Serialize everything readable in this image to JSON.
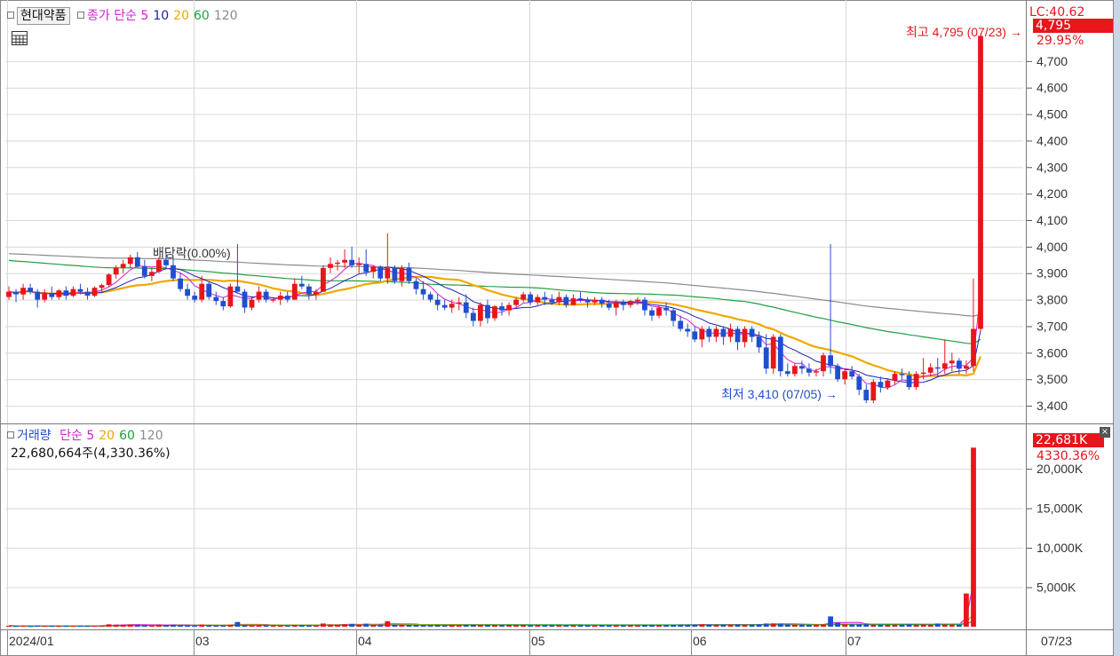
{
  "colors": {
    "up": "#e8151b",
    "down": "#1f4fd0",
    "ma5": "#d020d0",
    "ma10": "#2020b0",
    "ma20": "#f0a800",
    "ma60": "#20a040",
    "ma120": "#8a8a8a",
    "grid": "#d8d8d8",
    "panel_bg": "#c9d6e6"
  },
  "header": {
    "stock_name": "현대약품",
    "price_label": "종가 단순",
    "ma5": "5",
    "ma10": "10",
    "ma20": "20",
    "ma60": "60",
    "ma120": "120",
    "table_icon": "table-icon"
  },
  "price_panel": {
    "dividend_label": "배당락(0.00%)",
    "high_marker": "최고 4,795 (07/23) →",
    "low_marker": "최저 3,410 (07/05) →",
    "badge_top": "LC:40.62",
    "badge_price": "4,795",
    "badge_change": "29.95%",
    "axis_labels": [
      "4,700",
      "4,600",
      "4,500",
      "4,400",
      "4,300",
      "4,200",
      "4,100",
      "4,000",
      "3,900",
      "3,800",
      "3,700",
      "3,600",
      "3,500",
      "3,400"
    ]
  },
  "volume_panel": {
    "title": "거래량",
    "ma_label": "단순",
    "ma5": "5",
    "ma20": "20",
    "ma60": "60",
    "ma120": "120",
    "value_text": "22,680,664주(4,330.36%)",
    "badge_value": "22,681K",
    "badge_pct": "4330.36%",
    "axis_labels": [
      "20,000K",
      "15,000K",
      "10,000K",
      "5,000K"
    ]
  },
  "x_axis": {
    "labels": [
      "2024/01",
      "03",
      "04",
      "05",
      "06",
      "07"
    ],
    "right_label": "07/23"
  },
  "chart_data": {
    "type": "candlestick",
    "price_ylim": [
      3350,
      4830
    ],
    "volume_ylim": [
      0,
      23500
    ],
    "volume_unit": "K",
    "ohlc": [
      [
        3810,
        3850,
        3800,
        3830
      ],
      [
        3830,
        3840,
        3790,
        3820
      ],
      [
        3820,
        3860,
        3800,
        3845
      ],
      [
        3845,
        3860,
        3820,
        3830
      ],
      [
        3830,
        3840,
        3770,
        3800
      ],
      [
        3800,
        3840,
        3790,
        3825
      ],
      [
        3825,
        3850,
        3800,
        3810
      ],
      [
        3810,
        3840,
        3800,
        3835
      ],
      [
        3835,
        3850,
        3800,
        3815
      ],
      [
        3815,
        3850,
        3810,
        3840
      ],
      [
        3840,
        3860,
        3820,
        3830
      ],
      [
        3830,
        3845,
        3800,
        3815
      ],
      [
        3815,
        3850,
        3810,
        3845
      ],
      [
        3845,
        3860,
        3830,
        3855
      ],
      [
        3855,
        3900,
        3850,
        3895
      ],
      [
        3895,
        3930,
        3880,
        3920
      ],
      [
        3920,
        3950,
        3900,
        3935
      ],
      [
        3935,
        3970,
        3920,
        3960
      ],
      [
        3960,
        3980,
        3920,
        3925
      ],
      [
        3925,
        3950,
        3880,
        3890
      ],
      [
        3890,
        3920,
        3870,
        3905
      ],
      [
        3905,
        3960,
        3900,
        3950
      ],
      [
        3950,
        3980,
        3920,
        3930
      ],
      [
        3930,
        3960,
        3870,
        3880
      ],
      [
        3880,
        3900,
        3830,
        3840
      ],
      [
        3840,
        3860,
        3800,
        3815
      ],
      [
        3815,
        3830,
        3790,
        3800
      ],
      [
        3800,
        3890,
        3790,
        3860
      ],
      [
        3860,
        3870,
        3800,
        3810
      ],
      [
        3810,
        3830,
        3780,
        3795
      ],
      [
        3795,
        3810,
        3760,
        3775
      ],
      [
        3775,
        3860,
        3770,
        3850
      ],
      [
        3850,
        4010,
        3830,
        3830
      ],
      [
        3830,
        3840,
        3750,
        3770
      ],
      [
        3770,
        3810,
        3760,
        3800
      ],
      [
        3800,
        3850,
        3790,
        3830
      ],
      [
        3830,
        3840,
        3790,
        3800
      ],
      [
        3800,
        3810,
        3790,
        3800
      ],
      [
        3800,
        3830,
        3780,
        3815
      ],
      [
        3815,
        3830,
        3790,
        3800
      ],
      [
        3800,
        3880,
        3800,
        3860
      ],
      [
        3860,
        3890,
        3840,
        3850
      ],
      [
        3850,
        3860,
        3800,
        3820
      ],
      [
        3820,
        3840,
        3800,
        3830
      ],
      [
        3830,
        3930,
        3830,
        3920
      ],
      [
        3920,
        3960,
        3900,
        3935
      ],
      [
        3935,
        3950,
        3910,
        3940
      ],
      [
        3940,
        3990,
        3920,
        3950
      ],
      [
        3950,
        4000,
        3920,
        3930
      ],
      [
        3930,
        3960,
        3900,
        3935
      ],
      [
        3935,
        3990,
        3890,
        3905
      ],
      [
        3905,
        3930,
        3880,
        3925
      ],
      [
        3925,
        3930,
        3870,
        3880
      ],
      [
        3880,
        4050,
        3860,
        3920
      ],
      [
        3920,
        3930,
        3860,
        3870
      ],
      [
        3870,
        3930,
        3850,
        3920
      ],
      [
        3920,
        3940,
        3860,
        3870
      ],
      [
        3870,
        3880,
        3820,
        3840
      ],
      [
        3840,
        3870,
        3800,
        3820
      ],
      [
        3820,
        3830,
        3790,
        3800
      ],
      [
        3800,
        3820,
        3760,
        3780
      ],
      [
        3780,
        3800,
        3760,
        3770
      ],
      [
        3770,
        3800,
        3750,
        3785
      ],
      [
        3785,
        3810,
        3760,
        3790
      ],
      [
        3790,
        3820,
        3730,
        3750
      ],
      [
        3750,
        3770,
        3700,
        3720
      ],
      [
        3720,
        3790,
        3700,
        3780
      ],
      [
        3780,
        3800,
        3710,
        3730
      ],
      [
        3730,
        3780,
        3720,
        3775
      ],
      [
        3775,
        3790,
        3740,
        3760
      ],
      [
        3760,
        3790,
        3740,
        3780
      ],
      [
        3780,
        3810,
        3770,
        3800
      ],
      [
        3800,
        3830,
        3790,
        3820
      ],
      [
        3820,
        3830,
        3780,
        3790
      ],
      [
        3790,
        3820,
        3780,
        3810
      ],
      [
        3810,
        3830,
        3780,
        3800
      ],
      [
        3800,
        3820,
        3780,
        3790
      ],
      [
        3790,
        3830,
        3780,
        3810
      ],
      [
        3810,
        3820,
        3770,
        3780
      ],
      [
        3780,
        3820,
        3780,
        3805
      ],
      [
        3805,
        3830,
        3790,
        3800
      ],
      [
        3800,
        3810,
        3770,
        3790
      ],
      [
        3790,
        3810,
        3780,
        3800
      ],
      [
        3800,
        3810,
        3770,
        3785
      ],
      [
        3785,
        3800,
        3760,
        3770
      ],
      [
        3770,
        3800,
        3740,
        3790
      ],
      [
        3790,
        3800,
        3760,
        3780
      ],
      [
        3780,
        3800,
        3770,
        3795
      ],
      [
        3795,
        3810,
        3780,
        3800
      ],
      [
        3800,
        3810,
        3740,
        3760
      ],
      [
        3760,
        3770,
        3720,
        3740
      ],
      [
        3740,
        3780,
        3730,
        3770
      ],
      [
        3770,
        3790,
        3740,
        3760
      ],
      [
        3760,
        3770,
        3700,
        3720
      ],
      [
        3720,
        3740,
        3680,
        3690
      ],
      [
        3690,
        3710,
        3660,
        3680
      ],
      [
        3680,
        3700,
        3640,
        3650
      ],
      [
        3650,
        3700,
        3620,
        3690
      ],
      [
        3690,
        3700,
        3640,
        3660
      ],
      [
        3660,
        3700,
        3640,
        3690
      ],
      [
        3690,
        3700,
        3630,
        3660
      ],
      [
        3660,
        3710,
        3640,
        3690
      ],
      [
        3690,
        3700,
        3610,
        3640
      ],
      [
        3640,
        3700,
        3620,
        3690
      ],
      [
        3690,
        3700,
        3640,
        3660
      ],
      [
        3660,
        3680,
        3600,
        3620
      ],
      [
        3620,
        3670,
        3520,
        3540
      ],
      [
        3540,
        3670,
        3520,
        3660
      ],
      [
        3660,
        3670,
        3510,
        3530
      ],
      [
        3530,
        3560,
        3510,
        3520
      ],
      [
        3520,
        3560,
        3510,
        3550
      ],
      [
        3550,
        3570,
        3520,
        3540
      ],
      [
        3540,
        3560,
        3510,
        3525
      ],
      [
        3525,
        3540,
        3510,
        3530
      ],
      [
        3530,
        3600,
        3510,
        3590
      ],
      [
        3590,
        4010,
        3520,
        3550
      ],
      [
        3550,
        3560,
        3490,
        3500
      ],
      [
        3500,
        3540,
        3480,
        3530
      ],
      [
        3530,
        3550,
        3500,
        3510
      ],
      [
        3510,
        3520,
        3440,
        3460
      ],
      [
        3460,
        3480,
        3410,
        3420
      ],
      [
        3420,
        3500,
        3410,
        3490
      ],
      [
        3490,
        3510,
        3450,
        3470
      ],
      [
        3470,
        3500,
        3460,
        3495
      ],
      [
        3495,
        3530,
        3480,
        3520
      ],
      [
        3520,
        3540,
        3500,
        3515
      ],
      [
        3515,
        3530,
        3460,
        3470
      ],
      [
        3470,
        3530,
        3460,
        3520
      ],
      [
        3520,
        3580,
        3500,
        3525
      ],
      [
        3525,
        3560,
        3510,
        3545
      ],
      [
        3545,
        3580,
        3510,
        3540
      ],
      [
        3540,
        3650,
        3520,
        3560
      ],
      [
        3560,
        3600,
        3530,
        3570
      ],
      [
        3570,
        3580,
        3520,
        3540
      ],
      [
        3540,
        3570,
        3520,
        3550
      ],
      [
        3550,
        3880,
        3530,
        3690
      ],
      [
        3690,
        4795,
        3680,
        4795
      ]
    ],
    "volume": [
      120,
      90,
      110,
      80,
      130,
      100,
      90,
      95,
      85,
      110,
      100,
      90,
      120,
      150,
      300,
      260,
      240,
      280,
      220,
      200,
      180,
      260,
      230,
      250,
      200,
      170,
      160,
      280,
      190,
      160,
      170,
      250,
      600,
      220,
      170,
      190,
      160,
      150,
      170,
      150,
      230,
      200,
      170,
      160,
      400,
      260,
      220,
      300,
      350,
      260,
      380,
      220,
      240,
      700,
      250,
      260,
      220,
      200,
      190,
      180,
      200,
      180,
      210,
      190,
      240,
      260,
      230,
      220,
      210,
      190,
      200,
      220,
      230,
      190,
      200,
      190,
      180,
      200,
      190,
      210,
      200,
      190,
      180,
      200,
      190,
      210,
      180,
      200,
      190,
      220,
      230,
      210,
      200,
      230,
      250,
      240,
      260,
      300,
      260,
      240,
      250,
      260,
      280,
      250,
      260,
      300,
      400,
      420,
      380,
      300,
      260,
      280,
      250,
      260,
      300,
      1300,
      500,
      300,
      280,
      320,
      380,
      260,
      250,
      240,
      270,
      250,
      300,
      260,
      280,
      250,
      380,
      280,
      260,
      250,
      4200,
      22681
    ]
  }
}
